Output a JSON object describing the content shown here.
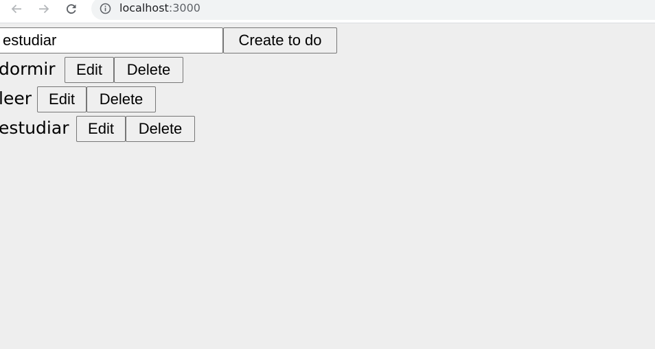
{
  "browser": {
    "url_host": "localhost",
    "url_port": ":3000"
  },
  "form": {
    "input_value": "estudiar",
    "create_label": "Create to do"
  },
  "todos": [
    {
      "text": "dormir",
      "edit_label": "Edit",
      "delete_label": "Delete"
    },
    {
      "text": "leer",
      "edit_label": "Edit",
      "delete_label": "Delete"
    },
    {
      "text": "estudiar",
      "edit_label": "Edit",
      "delete_label": "Delete"
    }
  ]
}
